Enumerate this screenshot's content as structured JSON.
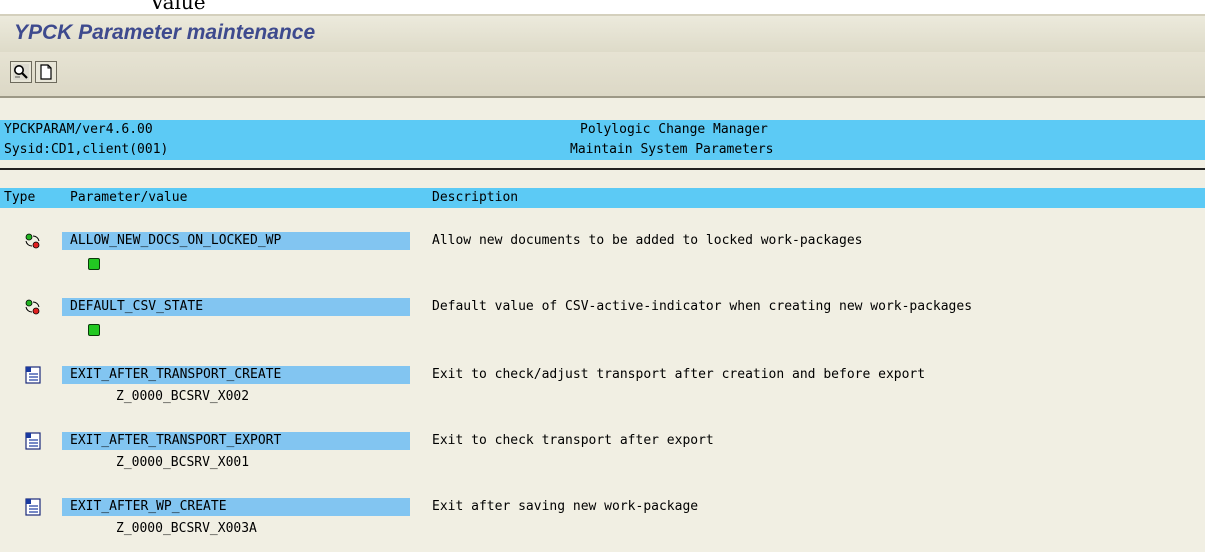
{
  "top_fragment": "Value",
  "window": {
    "title": "YPCK Parameter maintenance"
  },
  "toolbar": {
    "buttons": [
      {
        "name": "find",
        "icon": "magnifier-icon"
      },
      {
        "name": "new",
        "icon": "new-document-icon"
      }
    ]
  },
  "header": {
    "program": "YPCKPARAM/ver4.6.00",
    "app_title": "Polylogic Change Manager",
    "sysinfo": "Sysid:CD1,client(001)",
    "screen_title": "Maintain System Parameters"
  },
  "columns": {
    "type": "Type",
    "parameter": "Parameter/value",
    "description": "Description"
  },
  "rows": [
    {
      "type_icon": "toggle-traffic-icon",
      "name": "ALLOW_NEW_DOCS_ON_LOCKED_WP",
      "value": "",
      "value_kind": "green-indicator",
      "description": "Allow new documents to be added to locked work-packages"
    },
    {
      "type_icon": "toggle-traffic-icon",
      "name": "DEFAULT_CSV_STATE",
      "value": "",
      "value_kind": "green-indicator",
      "description": "Default value of CSV-active-indicator when creating new work-packages"
    },
    {
      "type_icon": "function-module-icon",
      "name": "EXIT_AFTER_TRANSPORT_CREATE",
      "value": "Z_0000_BCSRV_X002",
      "value_kind": "text",
      "description": "Exit to check/adjust transport after creation and before export"
    },
    {
      "type_icon": "function-module-icon",
      "name": "EXIT_AFTER_TRANSPORT_EXPORT",
      "value": "Z_0000_BCSRV_X001",
      "value_kind": "text",
      "description": "Exit to check transport after export"
    },
    {
      "type_icon": "function-module-icon",
      "name": "EXIT_AFTER_WP_CREATE",
      "value": "Z_0000_BCSRV_X003A",
      "value_kind": "text",
      "description": "Exit after saving new work-package"
    }
  ],
  "colors": {
    "title": "#3e4a8e",
    "header_band": "#5ccaf5",
    "param_highlight": "#82c5f1",
    "indicator_on": "#22c822"
  }
}
